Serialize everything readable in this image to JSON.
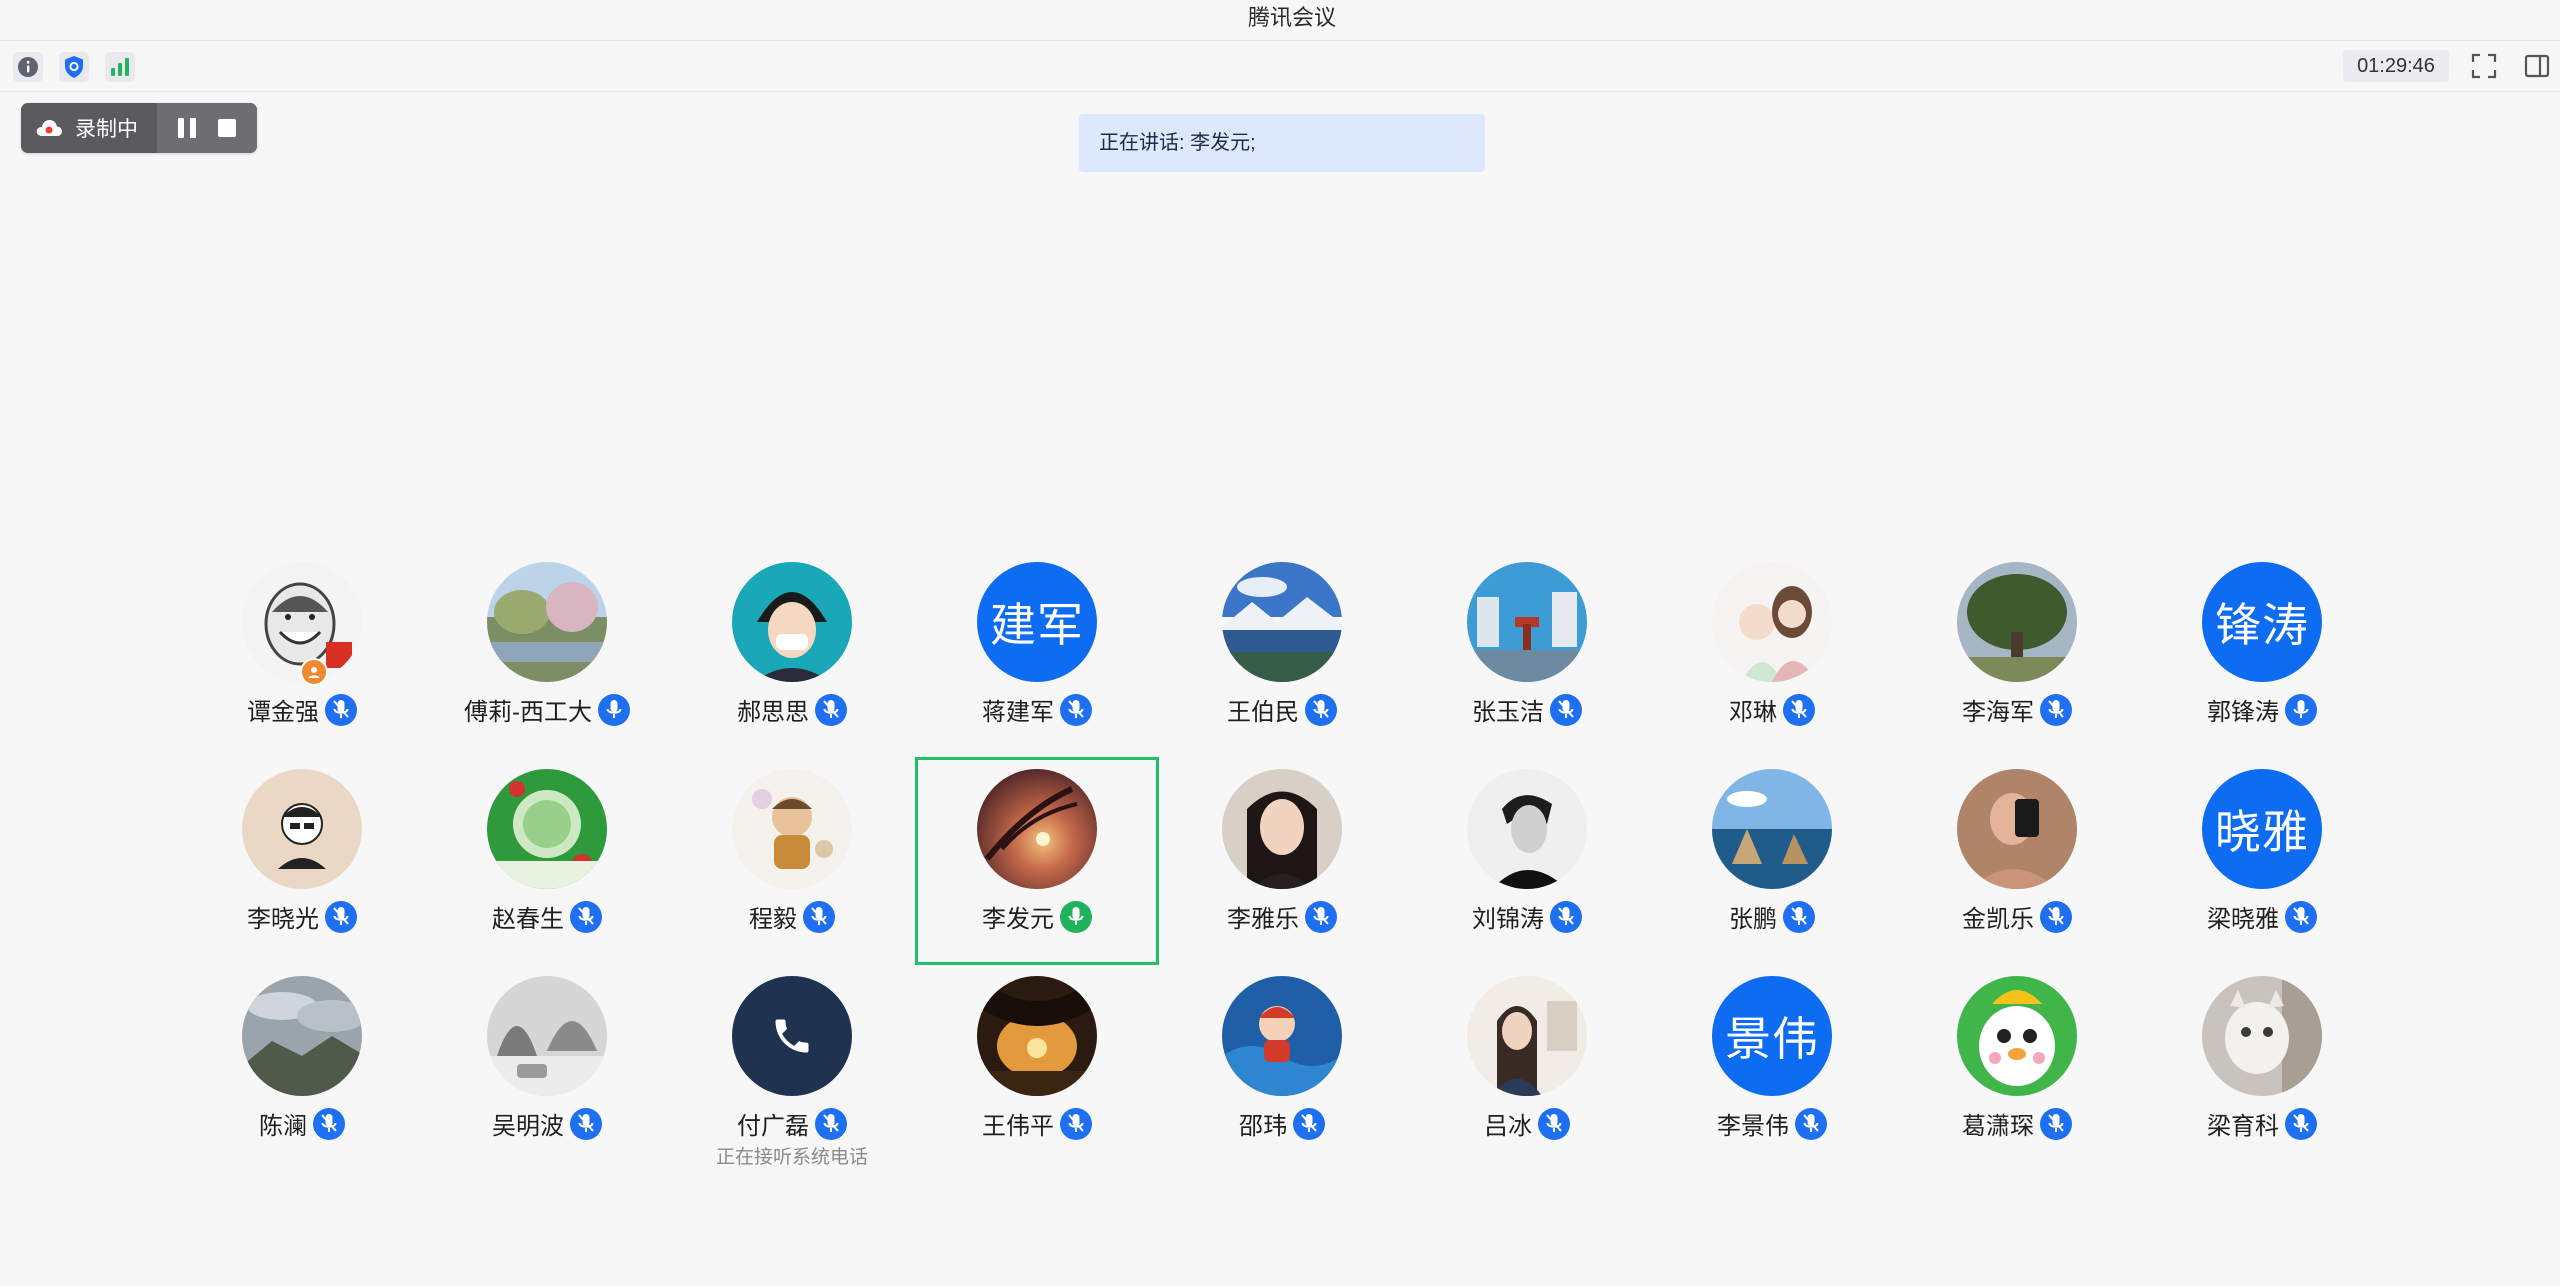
{
  "window": {
    "title": "腾讯会议"
  },
  "toolbar": {
    "icons": [
      "info-icon",
      "shield-icon",
      "signal-icon"
    ],
    "timer": "01:29:46",
    "right_icons": [
      "fullscreen-icon",
      "sidebar-toggle-icon"
    ]
  },
  "recording": {
    "label": "录制中",
    "icons": [
      "cloud-record-icon",
      "pause-icon",
      "stop-icon"
    ]
  },
  "speaking": {
    "text": "正在讲话: 李发元;"
  },
  "participants": [
    {
      "name": "谭金强",
      "avatar": "cartoon-face",
      "mic": "muted",
      "host": true
    },
    {
      "name": "傅莉-西工大",
      "avatar": "lake-trees",
      "mic": "on"
    },
    {
      "name": "郝思思",
      "avatar": "anime-girl",
      "mic": "muted"
    },
    {
      "name": "蒋建军",
      "avatar_text": "建军",
      "mic": "muted"
    },
    {
      "name": "王伯民",
      "avatar": "mountain-lake",
      "mic": "muted"
    },
    {
      "name": "张玉洁",
      "avatar": "city-fountain",
      "mic": "muted"
    },
    {
      "name": "邓琳",
      "avatar": "mother-baby-drawing",
      "mic": "muted"
    },
    {
      "name": "李海军",
      "avatar": "big-tree",
      "mic": "muted"
    },
    {
      "name": "郭锋涛",
      "avatar_text": "锋涛",
      "mic": "on"
    },
    {
      "name": "李晓光",
      "avatar": "cartoon-man",
      "mic": "muted"
    },
    {
      "name": "赵春生",
      "avatar": "fu-character-art",
      "mic": "muted"
    },
    {
      "name": "程毅",
      "avatar": "cartoon-figure",
      "mic": "muted"
    },
    {
      "name": "李发元",
      "avatar": "sunset-reeds",
      "mic": "speaking",
      "active": true
    },
    {
      "name": "李雅乐",
      "avatar": "woman-portrait",
      "mic": "muted"
    },
    {
      "name": "刘锦涛",
      "avatar": "man-portrait-bw",
      "mic": "muted"
    },
    {
      "name": "张鹏",
      "avatar": "sea-rocks",
      "mic": "muted"
    },
    {
      "name": "金凯乐",
      "avatar": "mirror-selfie",
      "mic": "muted"
    },
    {
      "name": "梁晓雅",
      "avatar_text": "晓雅",
      "mic": "muted"
    },
    {
      "name": "陈澜",
      "avatar": "cloudy-mountains",
      "mic": "muted"
    },
    {
      "name": "吴明波",
      "avatar": "snowy-street",
      "mic": "muted"
    },
    {
      "name": "付广磊",
      "avatar": "phone",
      "mic": "muted",
      "subtext": "正在接听系统电话"
    },
    {
      "name": "王伟平",
      "avatar": "sunset-cave",
      "mic": "muted"
    },
    {
      "name": "邵玮",
      "avatar": "ponyo",
      "mic": "muted"
    },
    {
      "name": "吕冰",
      "avatar": "girl-illustration",
      "mic": "muted"
    },
    {
      "name": "李景伟",
      "avatar_text": "景伟",
      "mic": "muted"
    },
    {
      "name": "葛潇琛",
      "avatar": "cartoon-chick",
      "mic": "muted"
    },
    {
      "name": "梁育科",
      "avatar": "white-cat",
      "mic": "muted"
    }
  ],
  "colors": {
    "accent": "#1e6ff1",
    "active_border": "#21c065",
    "speaking_mic": "#1fb45c",
    "banner_bg": "#dce9fd"
  }
}
